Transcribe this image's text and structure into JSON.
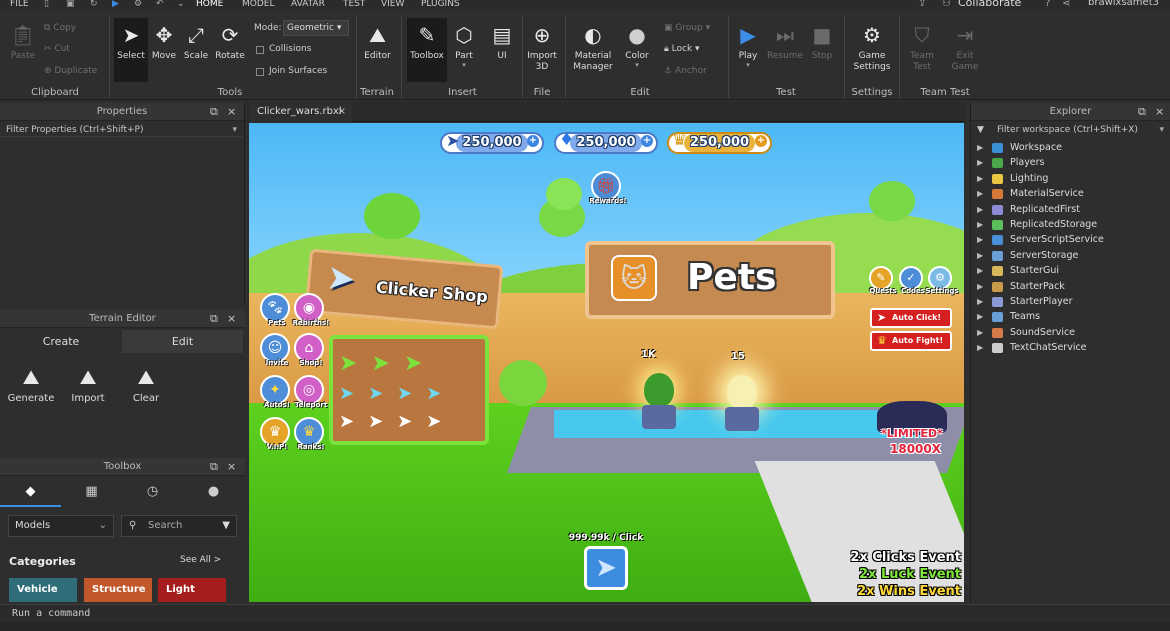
{
  "menu": {
    "file": "FILE",
    "home": "HOME",
    "model": "MODEL",
    "avatar": "AVATAR",
    "test": "TEST",
    "view": "VIEW",
    "plugins": "PLUGINS",
    "collaborate": "Collaborate",
    "username": "brawlxsamet3"
  },
  "clipboard": {
    "paste": "Paste",
    "copy": "Copy",
    "cut": "Cut",
    "duplicate": "Duplicate",
    "group": "Clipboard"
  },
  "tools": {
    "select": "Select",
    "move": "Move",
    "scale": "Scale",
    "rotate": "Rotate",
    "mode_label": "Mode:",
    "mode_value": "Geometric",
    "collisions": "Collisions",
    "join_surfaces": "Join Surfaces",
    "group": "Tools"
  },
  "terrain": {
    "editor": "Editor",
    "group": "Terrain"
  },
  "insert": {
    "toolbox": "Toolbox",
    "part": "Part",
    "ui": "UI",
    "group": "Insert"
  },
  "file": {
    "import3d": "Import 3D",
    "group": "File"
  },
  "edit": {
    "material_manager": "Material Manager",
    "color": "Color",
    "group_btn": "Group",
    "lock": "Lock",
    "anchor": "Anchor",
    "group": "Edit"
  },
  "test": {
    "play": "Play",
    "resume": "Resume",
    "stop": "Stop",
    "group": "Test"
  },
  "settings": {
    "game_settings": "Game Settings",
    "group": "Settings"
  },
  "teamtest": {
    "team_test": "Team Test",
    "exit_game": "Exit Game",
    "group": "Team Test"
  },
  "properties": {
    "title": "Properties",
    "filter": "Filter Properties (Ctrl+Shift+P)"
  },
  "terrain_editor": {
    "title": "Terrain Editor",
    "tab_create": "Create",
    "tab_edit": "Edit",
    "generate": "Generate",
    "import": "Import",
    "clear": "Clear"
  },
  "toolbox": {
    "title": "Toolbox",
    "dropdown": "Models",
    "search_placeholder": "Search",
    "categories": "Categories",
    "see_all": "See All >",
    "cat_vehicle": "Vehicle",
    "cat_structure": "Structure",
    "cat_light": "Light"
  },
  "document_tab": {
    "label": "Clicker_wars.rbxl",
    "close": "×"
  },
  "game": {
    "cursor_currency": "250,000",
    "gem_currency": "250,000",
    "trophy_currency": "250,000",
    "rewards": "Rewards!",
    "clicker_shop": "Clicker Shop",
    "pets": "Pets",
    "pets_side": "Pets",
    "rebirths": "Rebirths!",
    "invite": "Invite",
    "shop": "Shop!",
    "auto": "Autos!",
    "teleport": "Teleport",
    "vip": "V.I.P!",
    "rank": "Ranks!",
    "quests": "Quests",
    "codes": "Codes",
    "settings_btn": "Settings",
    "auto_click": "Auto Click!",
    "auto_fight": "Auto Fight!",
    "egg1_price": "1K",
    "egg2_price": "15",
    "limited": "*LIMITED*",
    "limited_mult": "18000X",
    "click_rate": "999.99k / Click",
    "event1": "2x Clicks Event",
    "event2": "2x Luck Event",
    "event3": "2x Wins Event"
  },
  "explorer": {
    "title": "Explorer",
    "filter": "Filter workspace (Ctrl+Shift+X)",
    "items": [
      {
        "name": "Workspace",
        "color": "#3a8fd6"
      },
      {
        "name": "Players",
        "color": "#4aa84a"
      },
      {
        "name": "Lighting",
        "color": "#e8c640"
      },
      {
        "name": "MaterialService",
        "color": "#d67a3a"
      },
      {
        "name": "ReplicatedFirst",
        "color": "#8a8ad6"
      },
      {
        "name": "ReplicatedStorage",
        "color": "#5bbf5b"
      },
      {
        "name": "ServerScriptService",
        "color": "#4a8fd6"
      },
      {
        "name": "ServerStorage",
        "color": "#6a9fd6"
      },
      {
        "name": "StarterGui",
        "color": "#d6b85a"
      },
      {
        "name": "StarterPack",
        "color": "#c89a4a"
      },
      {
        "name": "StarterPlayer",
        "color": "#8a9ad6"
      },
      {
        "name": "Teams",
        "color": "#6aa0d8"
      },
      {
        "name": "SoundService",
        "color": "#d67a4a"
      },
      {
        "name": "TextChatService",
        "color": "#cccccc"
      }
    ]
  },
  "command_bar": {
    "placeholder": "Run a command"
  }
}
